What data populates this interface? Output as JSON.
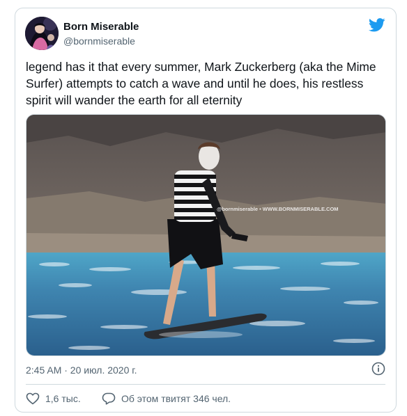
{
  "author": {
    "name": "Born Miserable",
    "handle": "@bornmiserable"
  },
  "tweet": {
    "text": "legend has it that every summer, Mark Zuckerberg (aka the Mime Surfer) attempts to catch a wave and until he does, his restless spirit will wander the earth for all eternity",
    "timestamp": "2:45 AM · 20 июл. 2020 г.",
    "likes": "1,6 тыс.",
    "discussion": "Об этом твитят 346 чел."
  },
  "photo": {
    "watermark": "@bornmiserable • WWW.BORNMISERABLE.COM"
  },
  "colors": {
    "twitter_blue": "#1d9bf0",
    "secondary_text": "#536471",
    "border": "#cfd9de"
  },
  "icons": {
    "brand": "twitter-bird-icon",
    "like": "heart-icon",
    "reply": "speech-bubble-icon",
    "info": "info-icon"
  }
}
